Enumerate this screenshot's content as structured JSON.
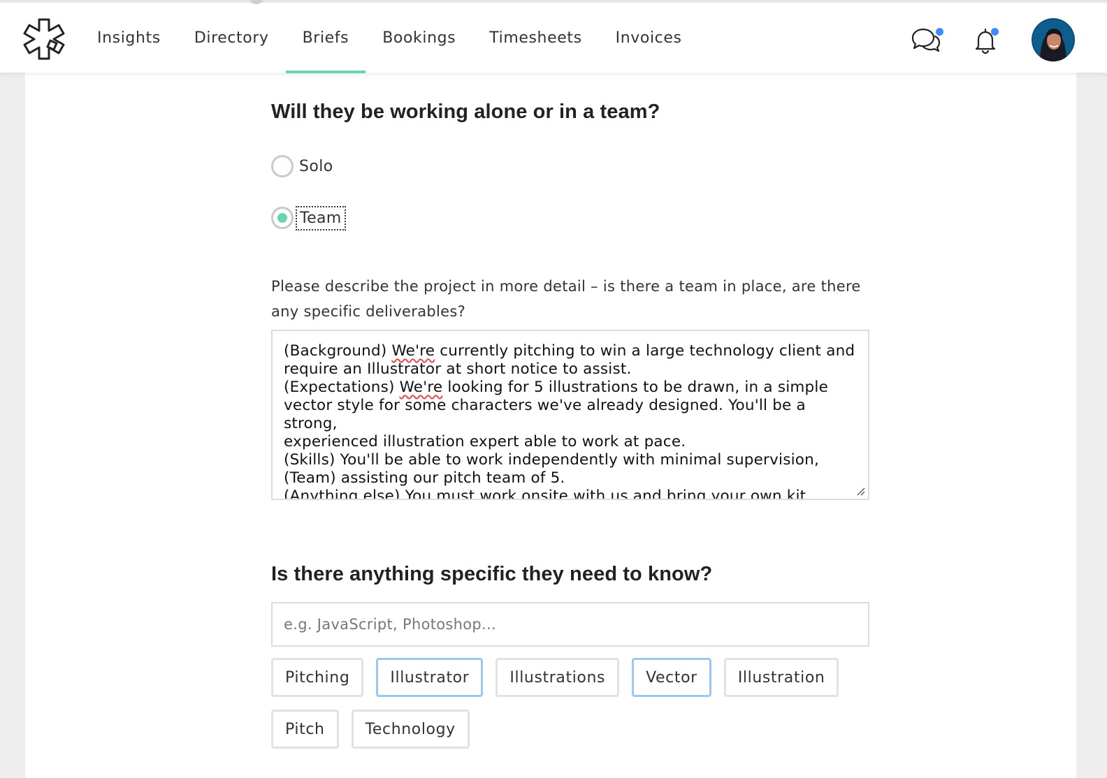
{
  "nav": {
    "items": [
      {
        "label": "Insights",
        "active": false
      },
      {
        "label": "Directory",
        "active": false
      },
      {
        "label": "Briefs",
        "active": true
      },
      {
        "label": "Bookings",
        "active": false
      },
      {
        "label": "Timesheets",
        "active": false
      },
      {
        "label": "Invoices",
        "active": false
      }
    ],
    "icons": [
      "messages-icon",
      "notifications-bell-icon"
    ],
    "accent_color": "#6cd3b1",
    "notification_dot_color": "#3d8cff"
  },
  "team_question": {
    "title": "Will they be working alone or in a team?",
    "options": [
      {
        "label": "Solo",
        "checked": false
      },
      {
        "label": "Team",
        "checked": true
      }
    ]
  },
  "details": {
    "prompt": "Please describe the project in more detail – is there a team in place, are there any specific deliverables?",
    "lines": [
      [
        "(Background) ",
        "We're",
        " currently pitching to win a large technology client and"
      ],
      [
        "require an Illustrator at short notice to assist."
      ],
      [
        "(Expectations) ",
        "We're",
        " looking for 5 illustrations to be drawn, in a simple"
      ],
      [
        "vector style for some characters we've already designed. You'll be a strong,"
      ],
      [
        "experienced illustration expert able to work at pace."
      ],
      [
        "(Skills) You'll be able to work independently with minimal supervision,"
      ],
      [
        "(Team) assisting our pitch team of 5."
      ],
      [
        "(Anything else) You must work onsite with us and bring your own kit."
      ]
    ]
  },
  "skills": {
    "title": "Is there anything specific they need to know?",
    "placeholder": "e.g. JavaScript, Photoshop...",
    "tags": [
      {
        "label": "Pitching",
        "selected": false
      },
      {
        "label": "Illustrator",
        "selected": true
      },
      {
        "label": "Illustrations",
        "selected": false
      },
      {
        "label": "Vector",
        "selected": true
      },
      {
        "label": "Illustration",
        "selected": false
      },
      {
        "label": "Pitch",
        "selected": false
      },
      {
        "label": "Technology",
        "selected": false
      }
    ]
  }
}
